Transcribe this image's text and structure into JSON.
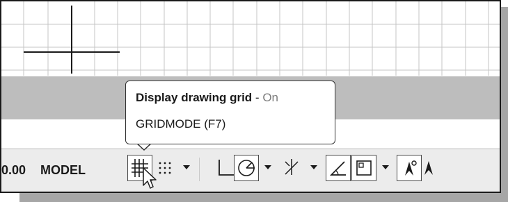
{
  "tooltip": {
    "title": "Display drawing grid",
    "separator": " - ",
    "state": "On",
    "command": "GRIDMODE (F7)"
  },
  "statusbar": {
    "coordinate": "0.00",
    "model_label": "MODEL"
  },
  "icons": [
    "grid-icon",
    "snap-icon",
    "ortho-icon",
    "polar-icon",
    "osnap-track-icon",
    "dynamic-ucs-icon",
    "selection-cycling-icon",
    "annotation-visibility-icon"
  ],
  "colors": {
    "canvas_bg": "#ffffff",
    "gray_band": "#bdbdbd",
    "statusbar_bg": "#ececec",
    "grid_lines": "#c4c4c4",
    "tooltip_state": "#7c7c7c"
  }
}
